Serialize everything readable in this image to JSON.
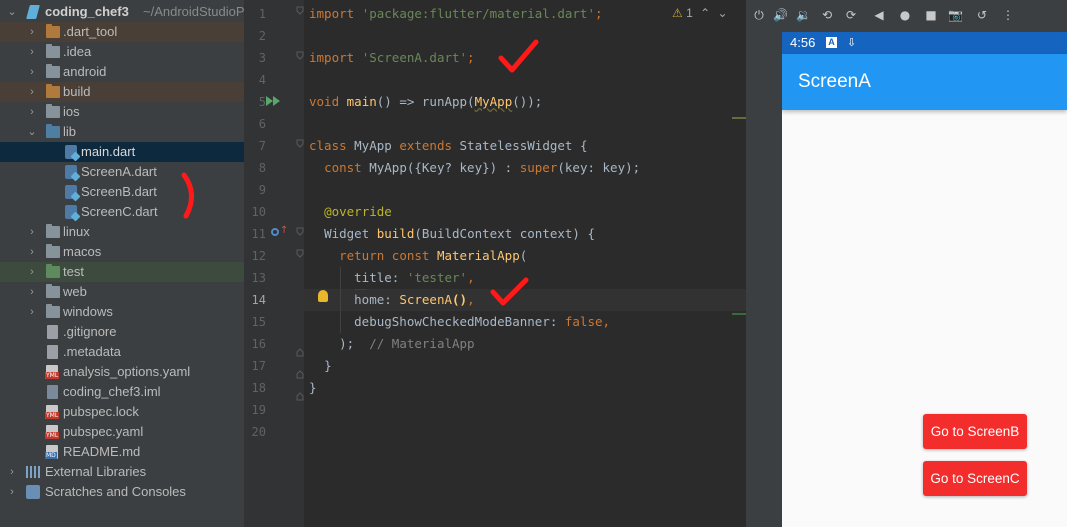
{
  "project": {
    "root_name": "coding_chef3",
    "root_path": "~/AndroidStudioP",
    "items": [
      {
        "label": "coding_chef3"
      },
      {
        "label": ".dart_tool"
      },
      {
        "label": ".idea"
      },
      {
        "label": "android"
      },
      {
        "label": "build"
      },
      {
        "label": "ios"
      },
      {
        "label": "lib"
      },
      {
        "label": "main.dart"
      },
      {
        "label": "ScreenA.dart"
      },
      {
        "label": "ScreenB.dart"
      },
      {
        "label": "ScreenC.dart"
      },
      {
        "label": "linux"
      },
      {
        "label": "macos"
      },
      {
        "label": "test"
      },
      {
        "label": "web"
      },
      {
        "label": "windows"
      },
      {
        "label": ".gitignore"
      },
      {
        "label": ".metadata"
      },
      {
        "label": "analysis_options.yaml"
      },
      {
        "label": "coding_chef3.iml"
      },
      {
        "label": "pubspec.lock"
      },
      {
        "label": "pubspec.yaml"
      },
      {
        "label": "README.md"
      },
      {
        "label": "External Libraries"
      },
      {
        "label": "Scratches and Consoles"
      }
    ]
  },
  "editor": {
    "line_numbers": [
      "1",
      "2",
      "3",
      "4",
      "5",
      "6",
      "7",
      "8",
      "9",
      "10",
      "11",
      "12",
      "13",
      "14",
      "15",
      "16",
      "17",
      "18",
      "19",
      "20"
    ],
    "current_line": "14",
    "warning_count": "1",
    "code": {
      "l1_kw": "import",
      "l1_str": "'package:flutter/material.dart'",
      "l1_end": ";",
      "l3_kw": "import",
      "l3_str": "'ScreenA.dart'",
      "l3_end": ";",
      "l5_a": "void ",
      "l5_fn": "main",
      "l5_b": "() => runApp(",
      "l5_fn2": "MyApp",
      "l5_c": "());",
      "l7_kw": "class ",
      "l7_a": "MyApp ",
      "l7_kw2": "extends ",
      "l7_b": "StatelessWidget {",
      "l8_kw": "const ",
      "l8_a": "MyApp({Key? key}) : ",
      "l8_kw2": "super",
      "l8_b": "(key: key);",
      "l10_ann": "@override",
      "l11_a": "Widget ",
      "l11_fn": "build",
      "l11_b": "(BuildContext context) {",
      "l12_kw": "return const ",
      "l12_fn": "MaterialApp",
      "l12_a": "(",
      "l13_a": "title: ",
      "l13_str": "'tester'",
      "l13_b": ",",
      "l14_a": "home: ",
      "l14_fn": "ScreenA",
      "l14_b": "()",
      "l14_c": ",",
      "l15_a": "debugShowCheckedModeBanner: ",
      "l15_kw": "false",
      "l15_b": ",",
      "l16_a": ");  ",
      "l16_cmt": "// MaterialApp",
      "l17_a": "}",
      "l18_a": "}"
    }
  },
  "emulator": {
    "time": "4:56",
    "status_icons": [
      "A",
      "⇩"
    ],
    "appbar_title": "ScreenA",
    "buttons": [
      "Go to ScreenB",
      "Go to ScreenC"
    ],
    "toolbar_icons": [
      "power-icon",
      "volume-up-icon",
      "volume-down-icon",
      "rotate-left-icon",
      "rotate-right-icon",
      "back-icon",
      "home-icon",
      "overview-icon",
      "camera-icon",
      "replay-icon",
      "more-icon"
    ]
  },
  "colors": {
    "appbar": "#2196f3",
    "statusbar": "#1565c0",
    "button": "#f32c2c",
    "annotation": "#ff1a1a"
  }
}
